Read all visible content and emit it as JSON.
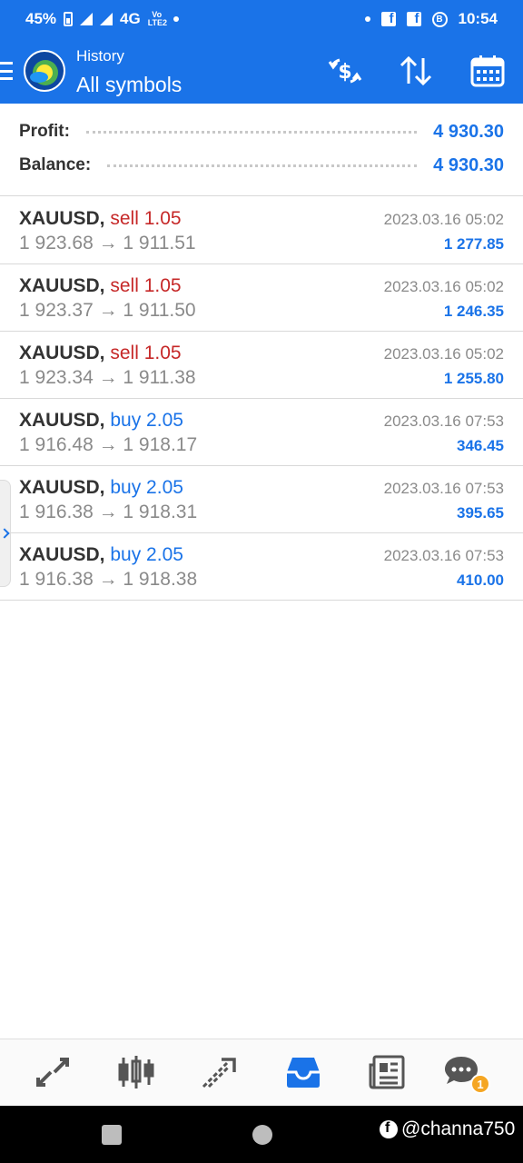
{
  "status_bar": {
    "battery": "45%",
    "network": "4G",
    "volte": "Vo LTE2",
    "time": "10:54"
  },
  "app_bar": {
    "title": "History",
    "subtitle": "All symbols",
    "icons": [
      "menu-icon",
      "metatrader-logo",
      "currency-exchange-icon",
      "sort-icon",
      "calendar-icon"
    ]
  },
  "summary": {
    "profit_label": "Profit:",
    "profit_value": "4 930.30",
    "balance_label": "Balance:",
    "balance_value": "4 930.30"
  },
  "deals": [
    {
      "symbol": "XAUUSD,",
      "side": "sell 1.05",
      "type": "sell",
      "prices": "1 923.68 → 1 911.51",
      "time": "2023.03.16 05:02",
      "profit": "1 277.85"
    },
    {
      "symbol": "XAUUSD,",
      "side": "sell 1.05",
      "type": "sell",
      "prices": "1 923.37 → 1 911.50",
      "time": "2023.03.16 05:02",
      "profit": "1 246.35"
    },
    {
      "symbol": "XAUUSD,",
      "side": "sell 1.05",
      "type": "sell",
      "prices": "1 923.34 → 1 911.38",
      "time": "2023.03.16 05:02",
      "profit": "1 255.80"
    },
    {
      "symbol": "XAUUSD,",
      "side": "buy 2.05",
      "type": "buy",
      "prices": "1 916.48 → 1 918.17",
      "time": "2023.03.16 07:53",
      "profit": "346.45"
    },
    {
      "symbol": "XAUUSD,",
      "side": "buy 2.05",
      "type": "buy",
      "prices": "1 916.38 → 1 918.31",
      "time": "2023.03.16 07:53",
      "profit": "395.65"
    },
    {
      "symbol": "XAUUSD,",
      "side": "buy 2.05",
      "type": "buy",
      "prices": "1 916.38 → 1 918.38",
      "time": "2023.03.16 07:53",
      "profit": "410.00"
    }
  ],
  "bottom_nav": {
    "items": [
      "quotes-icon",
      "chart-icon",
      "trade-icon",
      "history-icon",
      "news-icon",
      "chat-icon"
    ],
    "active": "history-icon",
    "chat_badge": "1"
  },
  "watermark": "@channa750",
  "colors": {
    "primary": "#1a73e8",
    "sell": "#c62828",
    "buy": "#1a73e8",
    "badge": "#f5a623"
  }
}
